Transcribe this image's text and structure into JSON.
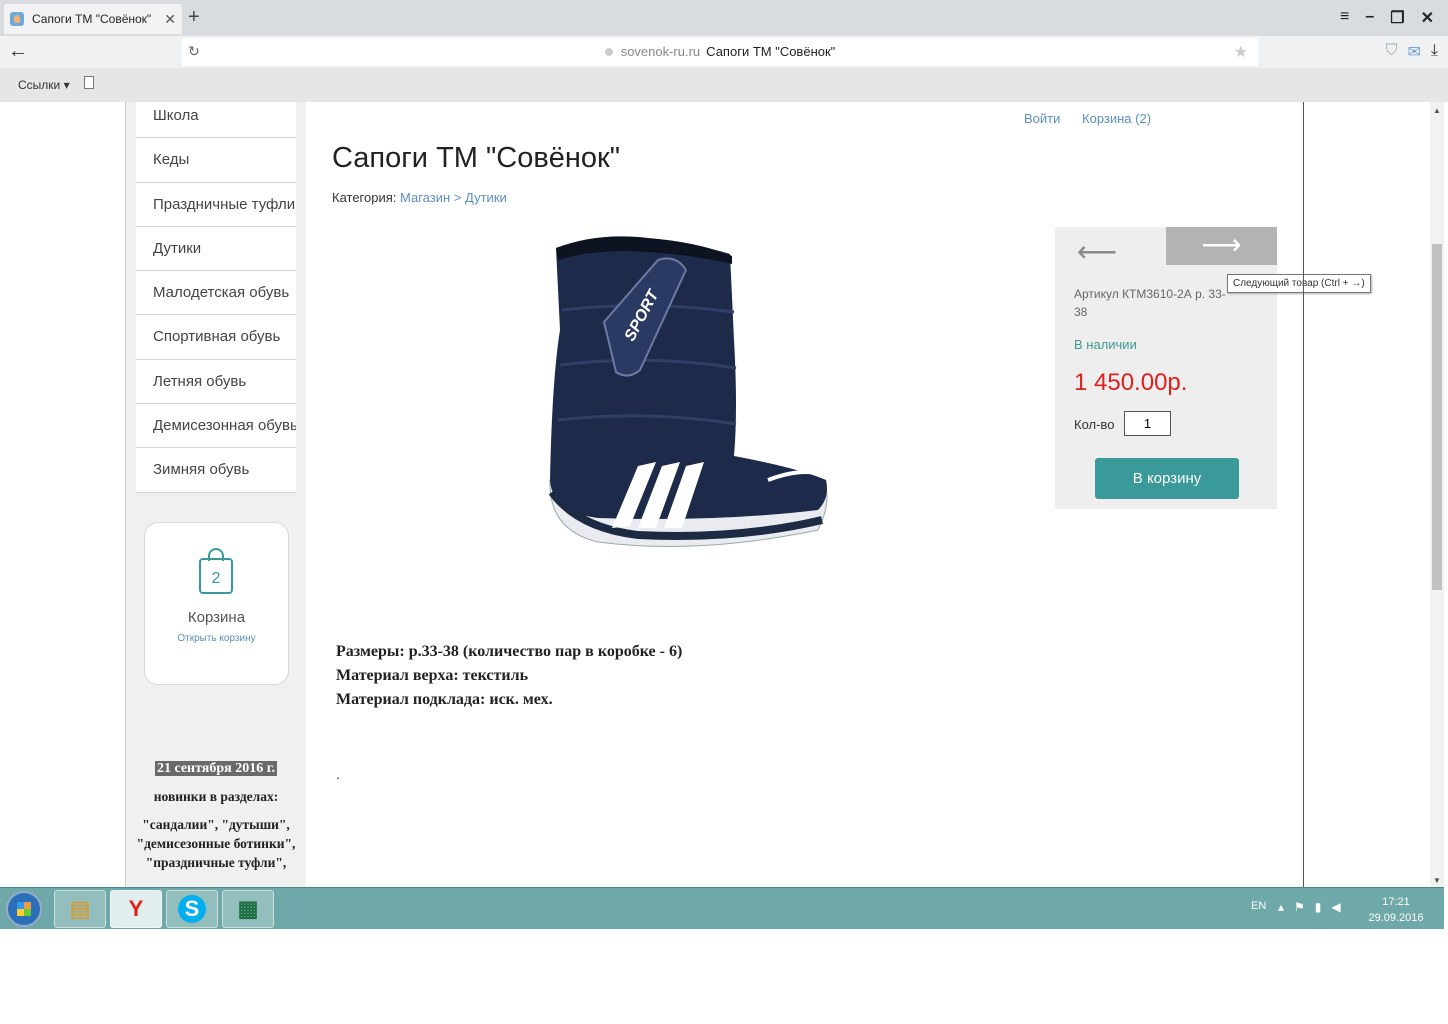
{
  "browser": {
    "tab_title": "Сапоги ТМ \"Совёнок\"",
    "url_host": "sovenok-ru.ru",
    "url_page_title": "Сапоги ТМ \"Совёнок\"",
    "bookmarks_label": "Ссылки ▾"
  },
  "sidebar": {
    "menu": [
      "Школа",
      "Кеды",
      "Праздничные туфли",
      "Дутики",
      "Малодетская обувь",
      "Спортивная обувь",
      "Летняя обувь",
      "Демисезонная обувь",
      "Зимняя обувь"
    ],
    "cart": {
      "count": "2",
      "title": "Корзина",
      "link": "Открыть корзину"
    },
    "news": {
      "date": "21 сентября 2016 г.",
      "heading": "новинки в разделах:",
      "body": "\"сандалии\", \"дутыши\", \"демисезонные ботинки\", \"праздничные туфли\","
    }
  },
  "header": {
    "login": "Войти",
    "cart": "Корзина (2)"
  },
  "product": {
    "title": "Сапоги ТМ \"Совёнок\"",
    "category_label": "Категория:",
    "breadcrumb": [
      "Магазин",
      "Дутики"
    ],
    "breadcrumb_sep": ">",
    "image_text": "SPORT",
    "sku": "Артикул КТМ3610-2А р. 33-38",
    "availability": "В наличии",
    "price": "1 450.00р.",
    "qty_label": "Кол-во",
    "qty_value": "1",
    "add_to_cart": "В корзину",
    "next_tooltip": "Следующий товар (Ctrl + →)",
    "description": [
      "Размеры: р.33-38 (количество пар в коробке - 6)",
      "Материал верха: текстиль",
      "Материал подклада: иск. мех."
    ],
    "trailing_dot": "."
  },
  "taskbar": {
    "language": "EN",
    "time": "17:21",
    "date": "29.09.2016"
  },
  "colors": {
    "accent_teal": "#3a9a9a",
    "link_blue": "#5a8fc0",
    "price_red": "#e02020",
    "taskbar": "#6fa8a8"
  },
  "icons": [
    "search-icon",
    "reload-icon",
    "star-icon",
    "shield-icon",
    "mail-icon",
    "download-icon",
    "shopping-bag-icon",
    "arrow-left-icon",
    "arrow-right-icon",
    "windows-start-icon",
    "explorer-icon",
    "yandex-icon",
    "skype-icon",
    "excel-icon",
    "flag-icon",
    "volume-icon"
  ]
}
